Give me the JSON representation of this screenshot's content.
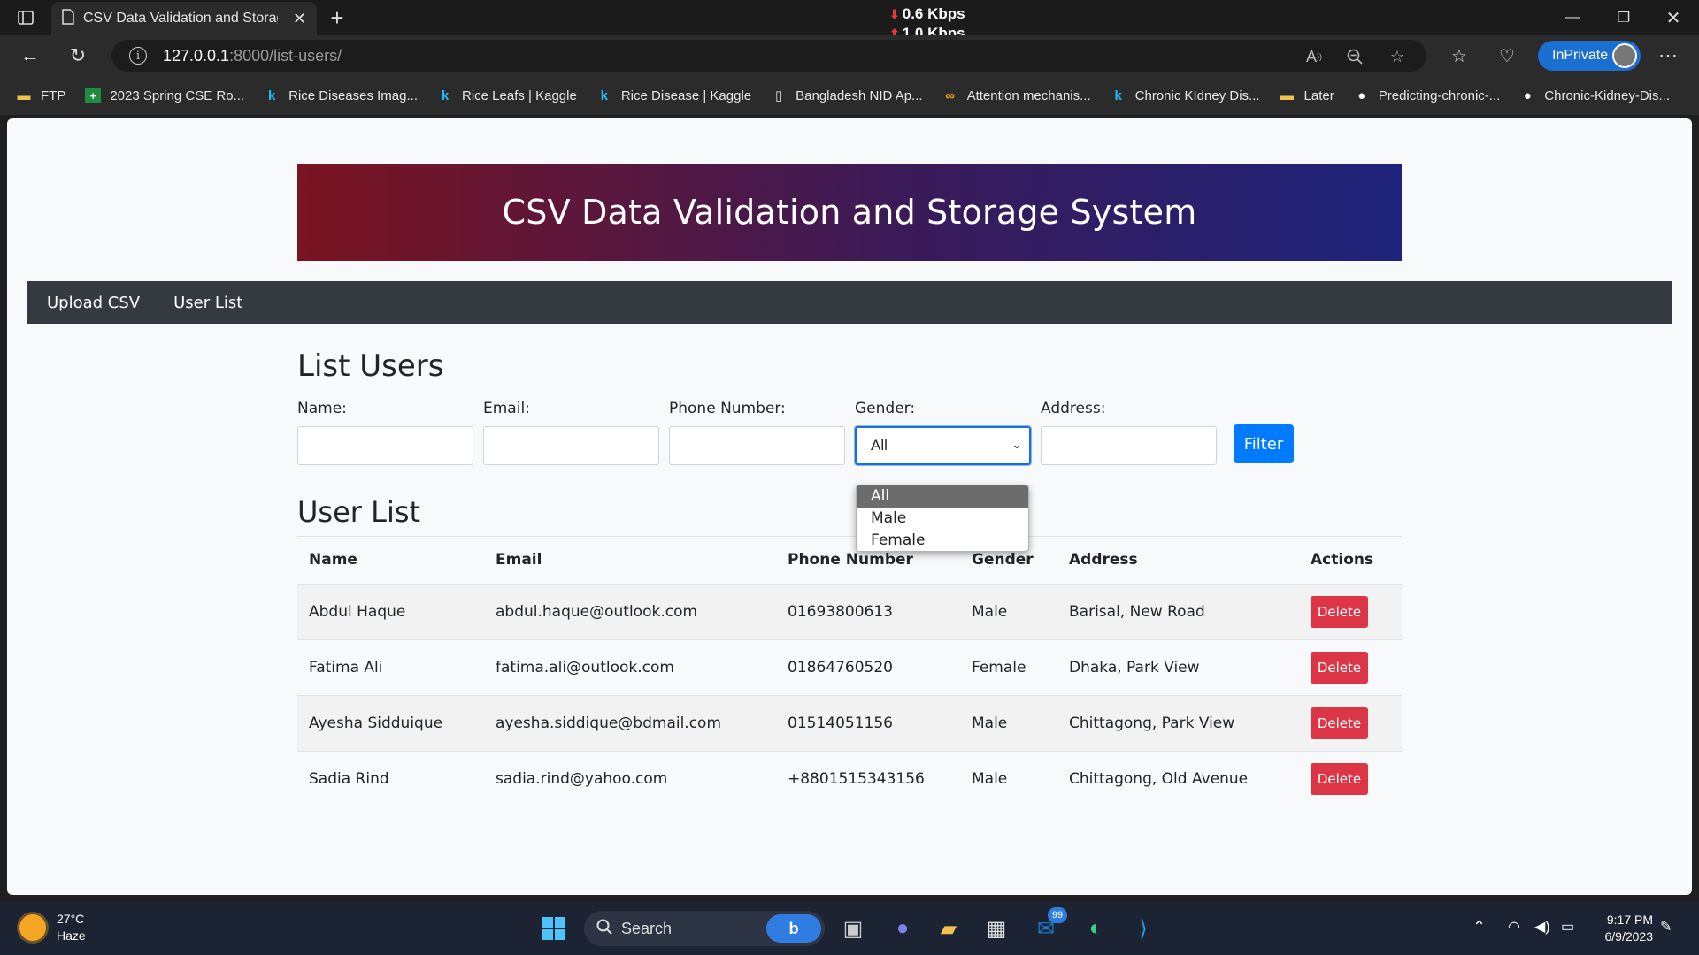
{
  "browser": {
    "tab_title": "CSV Data Validation and Storage",
    "net_down": "0.6 Kbps",
    "net_up": "1.0 Kbps",
    "url_host": "127.0.0.1",
    "url_path": ":8000/list-users/",
    "inprivate_label": "InPrivate",
    "bookmarks": [
      {
        "label": "FTP",
        "icon": "folder-icon"
      },
      {
        "label": "2023 Spring CSE Ro...",
        "icon": "sheets-icon"
      },
      {
        "label": "Rice Diseases Imag...",
        "icon": "kaggle-icon"
      },
      {
        "label": "Rice Leafs | Kaggle",
        "icon": "kaggle-icon"
      },
      {
        "label": "Rice Disease | Kaggle",
        "icon": "kaggle-icon"
      },
      {
        "label": "Bangladesh NID Ap...",
        "icon": "page-icon"
      },
      {
        "label": "Attention mechanis...",
        "icon": "colab-icon"
      },
      {
        "label": "Chronic KIdney Dis...",
        "icon": "kaggle-icon"
      },
      {
        "label": "Later",
        "icon": "folder-icon"
      },
      {
        "label": "Predicting-chronic-...",
        "icon": "github-icon"
      },
      {
        "label": "Chronic-Kidney-Dis...",
        "icon": "github-icon"
      }
    ]
  },
  "page": {
    "banner_title": "CSV Data Validation and Storage System",
    "nav": [
      "Upload CSV",
      "User List"
    ],
    "list_heading": "List Users",
    "filters": {
      "name_label": "Name:",
      "email_label": "Email:",
      "phone_label": "Phone Number:",
      "gender_label": "Gender:",
      "address_label": "Address:",
      "gender_selected": "All",
      "gender_options": [
        "All",
        "Male",
        "Female"
      ],
      "filter_button": "Filter"
    },
    "users_heading": "User List",
    "table": {
      "headers": [
        "Name",
        "Email",
        "Phone Number",
        "Gender",
        "Address",
        "Actions"
      ],
      "rows": [
        {
          "name": "Abdul Haque",
          "email": "abdul.haque@outlook.com",
          "phone": "01693800613",
          "gender": "Male",
          "address": "Barisal, New Road",
          "action": "Delete"
        },
        {
          "name": "Fatima Ali",
          "email": "fatima.ali@outlook.com",
          "phone": "01864760520",
          "gender": "Female",
          "address": "Dhaka, Park View",
          "action": "Delete"
        },
        {
          "name": "Ayesha Sidduique",
          "email": "ayesha.siddique@bdmail.com",
          "phone": "01514051156",
          "gender": "Male",
          "address": "Chittagong, Park View",
          "action": "Delete"
        },
        {
          "name": "Sadia Rind",
          "email": "sadia.rind@yahoo.com",
          "phone": "+8801515343156",
          "gender": "Male",
          "address": "Chittagong, Old Avenue",
          "action": "Delete"
        }
      ]
    }
  },
  "taskbar": {
    "temperature": "27°C",
    "weather": "Haze",
    "search_label": "Search",
    "mail_badge": "99",
    "time": "9:17 PM",
    "date": "6/9/2023"
  },
  "colors": {
    "banner_start": "#7a1420",
    "banner_end": "#1d237a",
    "nav_bg": "#343a40",
    "filter_button": "#007bff",
    "delete_button": "#dc3545"
  }
}
